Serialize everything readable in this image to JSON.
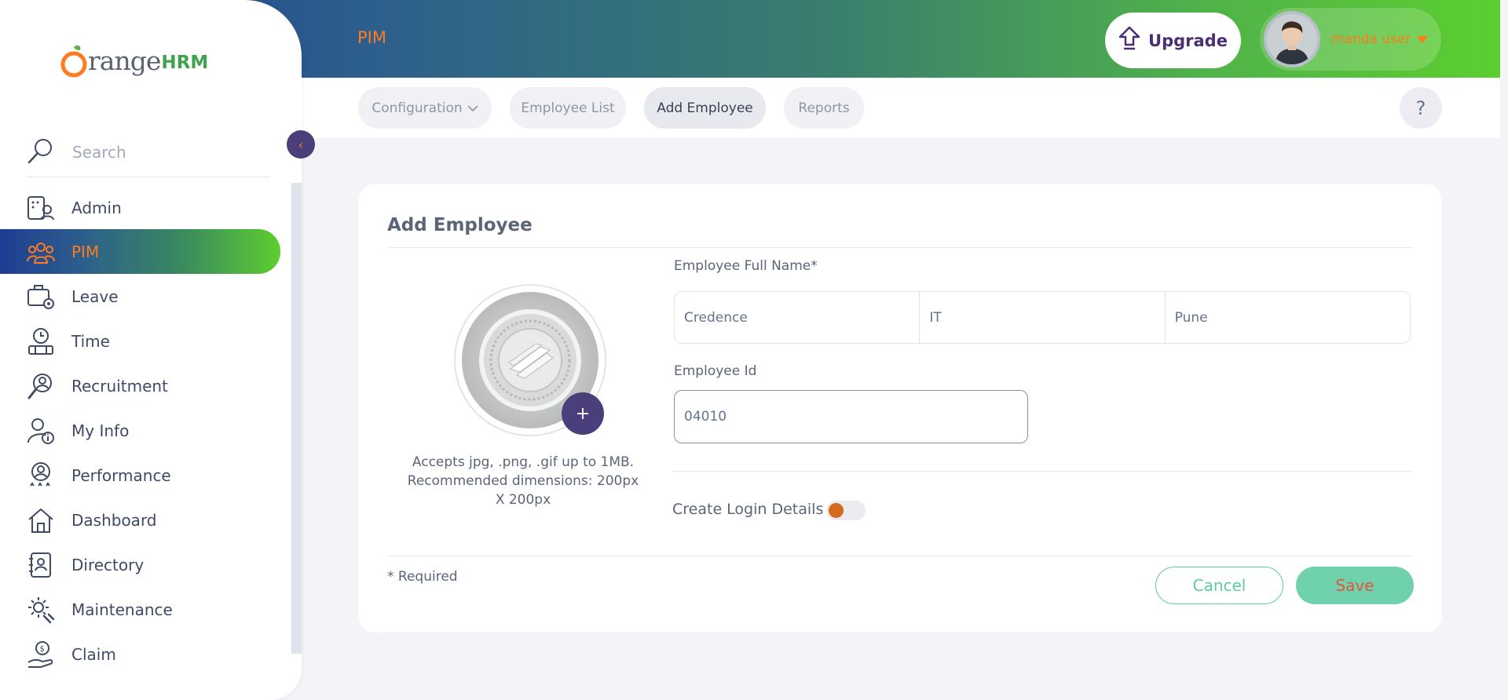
{
  "header": {
    "module_title": "PIM",
    "upgrade_label": "Upgrade",
    "user_name": "manda user"
  },
  "subnav": {
    "tabs": [
      {
        "label": "Configuration",
        "has_dropdown": true,
        "active": false
      },
      {
        "label": "Employee List",
        "active": false
      },
      {
        "label": "Add Employee",
        "active": true
      },
      {
        "label": "Reports",
        "active": false
      }
    ],
    "help_label": "?"
  },
  "sidebar": {
    "logo_word": "range",
    "logo_hrm": "HRM",
    "search_placeholder": "Search",
    "items": [
      {
        "label": "Admin",
        "icon": "admin-icon"
      },
      {
        "label": "PIM",
        "icon": "pim-icon",
        "active": true
      },
      {
        "label": "Leave",
        "icon": "leave-icon"
      },
      {
        "label": "Time",
        "icon": "time-icon"
      },
      {
        "label": "Recruitment",
        "icon": "recruitment-icon"
      },
      {
        "label": "My Info",
        "icon": "my-info-icon"
      },
      {
        "label": "Performance",
        "icon": "performance-icon"
      },
      {
        "label": "Dashboard",
        "icon": "dashboard-icon"
      },
      {
        "label": "Directory",
        "icon": "directory-icon"
      },
      {
        "label": "Maintenance",
        "icon": "maintenance-icon"
      },
      {
        "label": "Claim",
        "icon": "claim-icon"
      }
    ]
  },
  "form": {
    "title": "Add Employee",
    "photo_hint": "Accepts jpg, .png, .gif up to 1MB. Recommended dimensions: 200px X 200px",
    "full_name_label": "Employee Full Name*",
    "first_name": "Credence",
    "middle_name": "IT",
    "last_name": "Pune",
    "employee_id_label": "Employee Id",
    "employee_id": "04010",
    "create_login_label": "Create Login Details",
    "create_login_enabled": false,
    "required_note": "* Required",
    "cancel_label": "Cancel",
    "save_label": "Save"
  },
  "colors": {
    "accent_orange": "#ff7b1d",
    "brand_purple": "#4a3f7a",
    "success_green": "#70d1ad"
  }
}
